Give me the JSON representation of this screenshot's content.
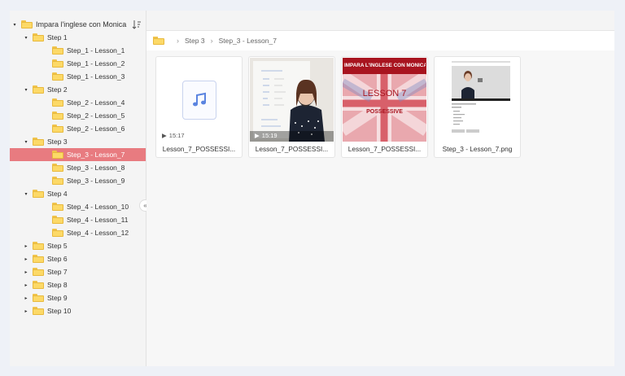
{
  "tree": {
    "root": {
      "label": "Impara l'inglese con Monica"
    },
    "nodes": [
      {
        "label": "Step 1",
        "level": 1,
        "arrow": "▾"
      },
      {
        "label": "Step_1 - Lesson_1",
        "level": 2,
        "arrow": ""
      },
      {
        "label": "Step_1 - Lesson_2",
        "level": 2,
        "arrow": ""
      },
      {
        "label": "Step_1 - Lesson_3",
        "level": 2,
        "arrow": ""
      },
      {
        "label": "Step 2",
        "level": 1,
        "arrow": "▾"
      },
      {
        "label": "Step_2 - Lesson_4",
        "level": 2,
        "arrow": ""
      },
      {
        "label": "Step_2 - Lesson_5",
        "level": 2,
        "arrow": ""
      },
      {
        "label": "Step_2 - Lesson_6",
        "level": 2,
        "arrow": ""
      },
      {
        "label": "Step 3",
        "level": 1,
        "arrow": "▾"
      },
      {
        "label": "Step_3 - Lesson_7",
        "level": 2,
        "arrow": "",
        "selected": true
      },
      {
        "label": "Step_3 - Lesson_8",
        "level": 2,
        "arrow": ""
      },
      {
        "label": "Step_3 - Lesson_9",
        "level": 2,
        "arrow": ""
      },
      {
        "label": "Step 4",
        "level": 1,
        "arrow": "▾"
      },
      {
        "label": "Step_4 - Lesson_10",
        "level": 2,
        "arrow": ""
      },
      {
        "label": "Step_4 - Lesson_11",
        "level": 2,
        "arrow": ""
      },
      {
        "label": "Step_4 - Lesson_12",
        "level": 2,
        "arrow": ""
      },
      {
        "label": "Step 5",
        "level": 1,
        "arrow": "▸"
      },
      {
        "label": "Step 6",
        "level": 1,
        "arrow": "▸"
      },
      {
        "label": "Step 7",
        "level": 1,
        "arrow": "▸"
      },
      {
        "label": "Step 8",
        "level": 1,
        "arrow": "▸"
      },
      {
        "label": "Step 9",
        "level": 1,
        "arrow": "▸"
      },
      {
        "label": "Step 10",
        "level": 1,
        "arrow": "▸"
      }
    ]
  },
  "breadcrumb": {
    "items": [
      "Step 3",
      "Step_3 - Lesson_7"
    ]
  },
  "files": [
    {
      "name": "Lesson_7_POSSESSI...",
      "type": "audio",
      "duration": "15:17"
    },
    {
      "name": "Lesson_7_POSSESSI...",
      "type": "video",
      "duration": "15:19"
    },
    {
      "name": "Lesson_7_POSSESSI...",
      "type": "image",
      "banner": "IMPARA L'INGLESE CON MONICA",
      "title": "LESSON 7",
      "subtitle": "POSSESSIVE"
    },
    {
      "name": "Step_3 - Lesson_7.png",
      "type": "screenshot"
    }
  ],
  "colors": {
    "selected": "#e87b80",
    "folder": "#fcd967",
    "audio_icon": "#5b84e0"
  }
}
